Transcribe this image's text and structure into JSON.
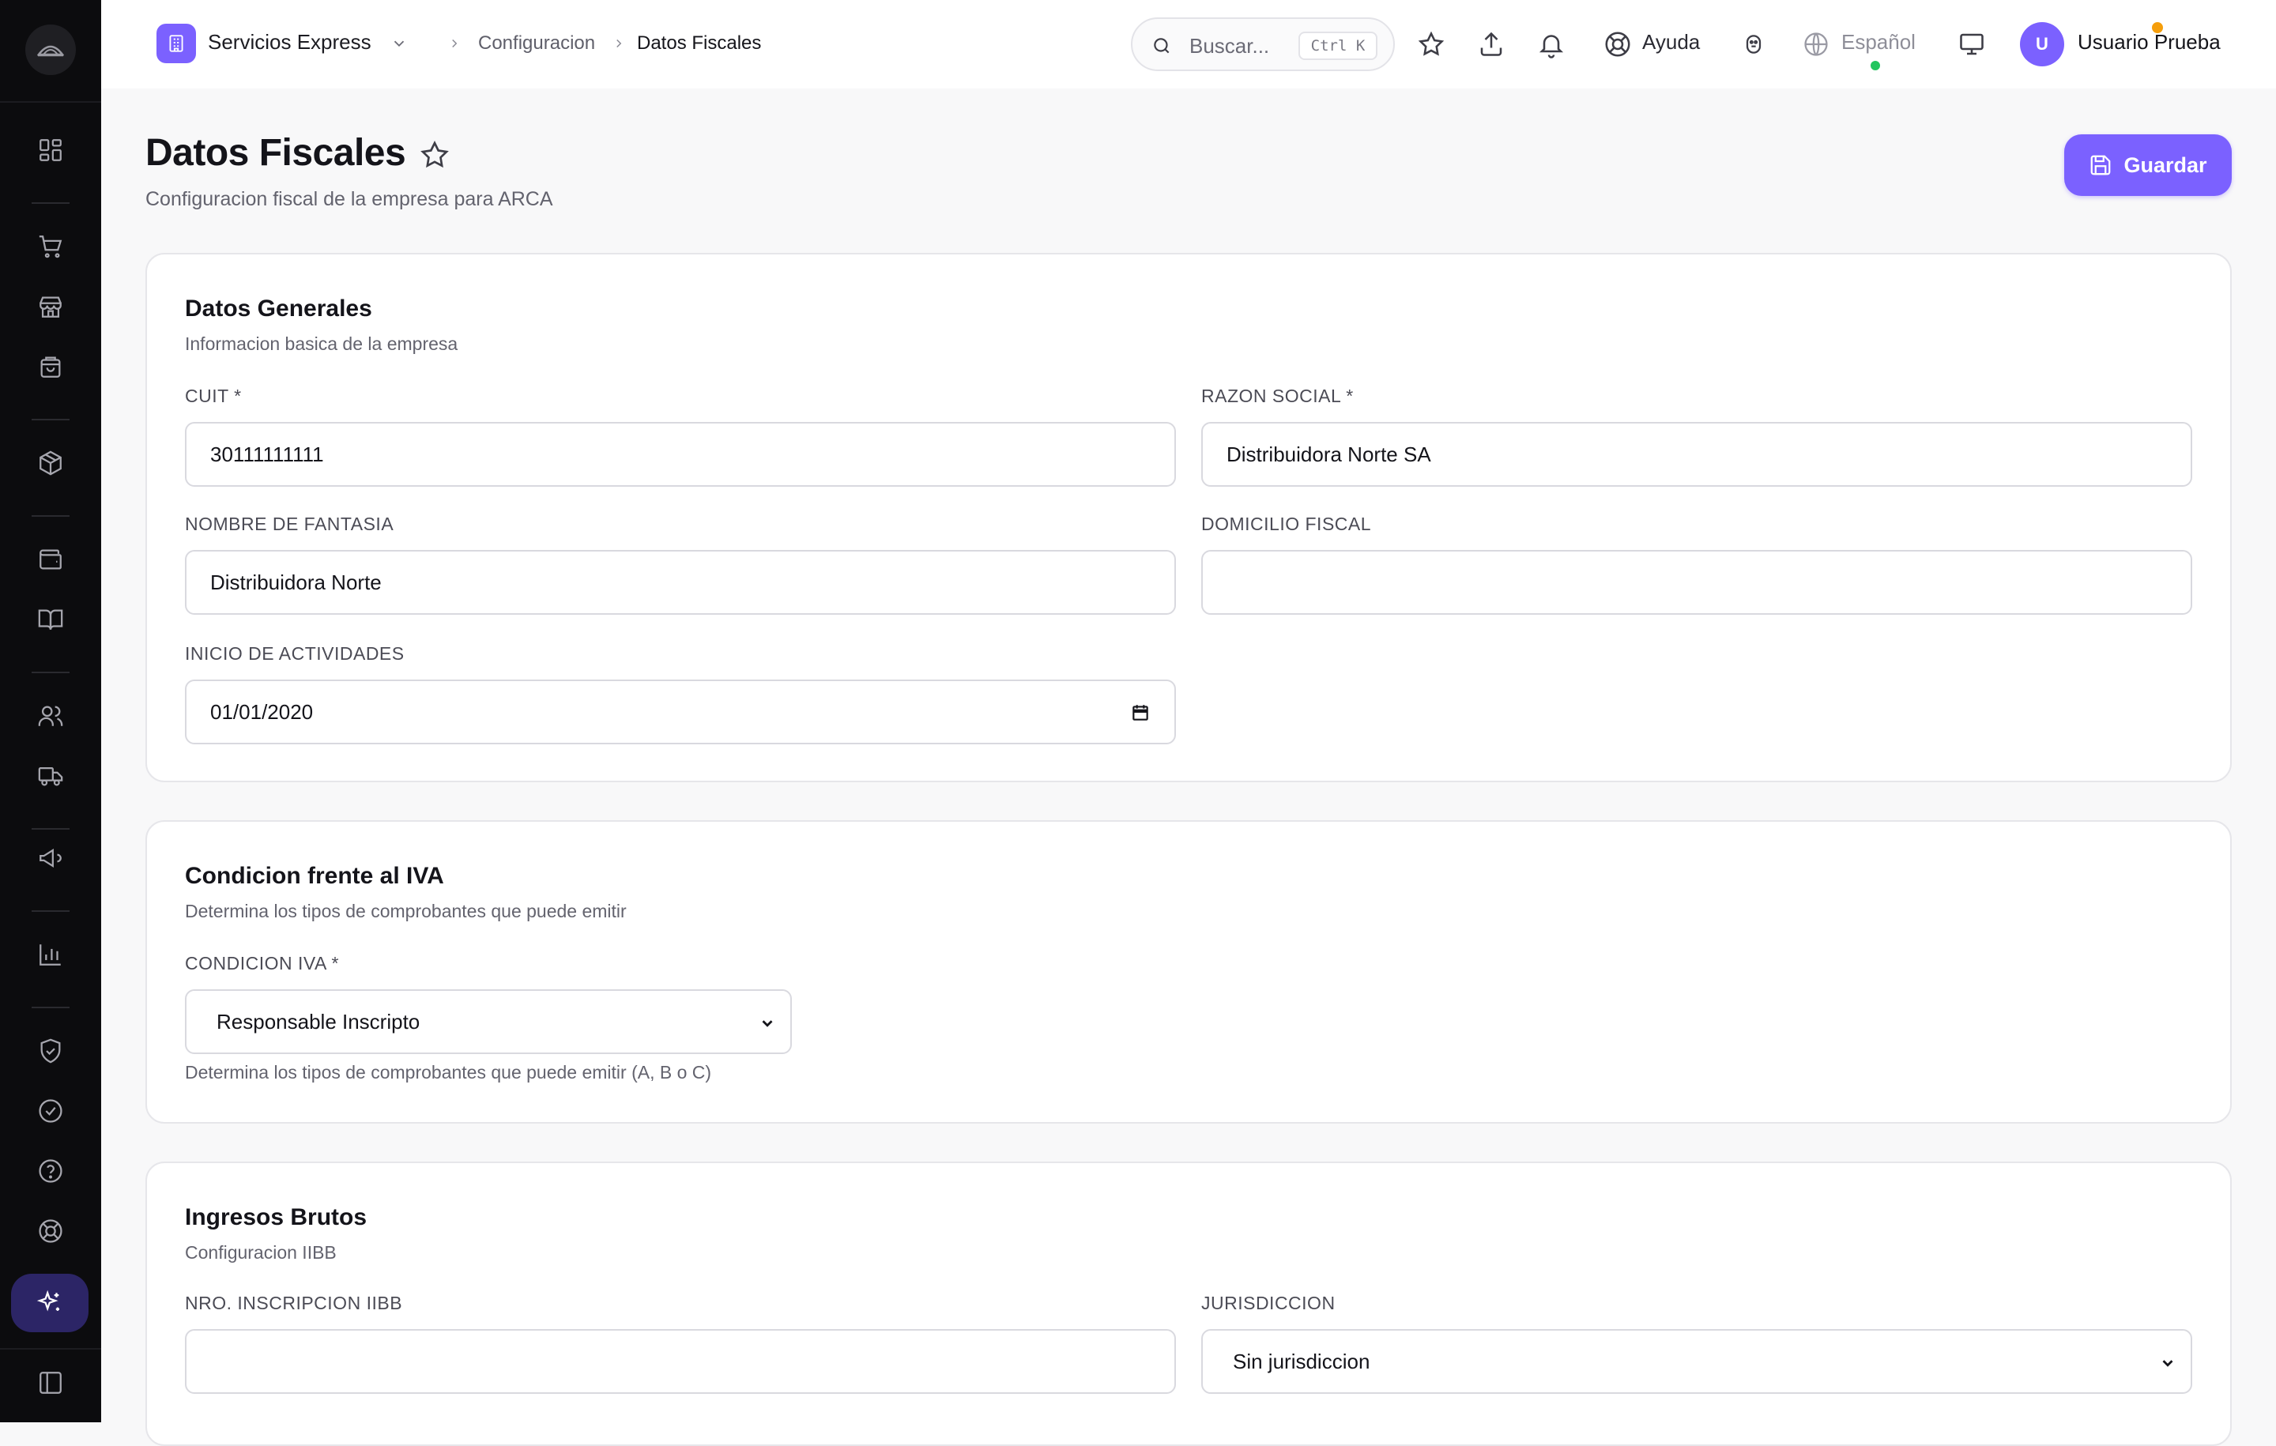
{
  "sidebar": {
    "icons": [
      "dashboard-icon",
      "cart-icon",
      "store-icon",
      "shopping-bag-icon",
      "package-icon",
      "wallet-icon",
      "book-icon",
      "users-icon",
      "truck-icon",
      "megaphone-icon",
      "bar-chart-icon",
      "shield-check-icon",
      "check-circle-icon",
      "help-circle-icon",
      "lifebuoy-icon",
      "sparkles-icon",
      "sidebar-toggle-icon"
    ]
  },
  "topbar": {
    "workspace_name": "Servicios Express",
    "breadcrumb": [
      "Configuracion",
      "Datos Fiscales"
    ],
    "search_placeholder": "Buscar...",
    "search_shortcut": "Ctrl K",
    "help_label": "Ayuda",
    "language_label": "Español",
    "user_initial": "U",
    "user_name": "Usuario Prueba"
  },
  "page": {
    "title": "Datos Fiscales",
    "subtitle": "Configuracion fiscal de la empresa para ARCA",
    "save_label": "Guardar"
  },
  "general": {
    "title": "Datos Generales",
    "description": "Informacion basica de la empresa",
    "cuit_label": "CUIT *",
    "cuit_value": "30111111111",
    "razon_label": "RAZON SOCIAL *",
    "razon_value": "Distribuidora Norte SA",
    "fantasia_label": "NOMBRE DE FANTASIA",
    "fantasia_value": "Distribuidora Norte",
    "domicilio_label": "DOMICILIO FISCAL",
    "domicilio_value": "",
    "inicio_label": "INICIO DE ACTIVIDADES",
    "inicio_value": "01/01/2020"
  },
  "iva": {
    "title": "Condicion frente al IVA",
    "description": "Determina los tipos de comprobantes que puede emitir",
    "condicion_label": "CONDICION IVA *",
    "condicion_value": "Responsable Inscripto",
    "hint": "Determina los tipos de comprobantes que puede emitir (A, B o C)"
  },
  "iibb": {
    "title": "Ingresos Brutos",
    "description": "Configuracion IIBB",
    "nro_label": "NRO. INSCRIPCION IIBB",
    "nro_value": "",
    "jurisdiccion_label": "JURISDICCION",
    "jurisdiccion_value": "Sin jurisdiccion"
  },
  "colors": {
    "accent": "#7b61ff",
    "sidebar_bg": "#0c0c0e",
    "status_online": "#22c55e",
    "notification": "#f59e0b"
  }
}
